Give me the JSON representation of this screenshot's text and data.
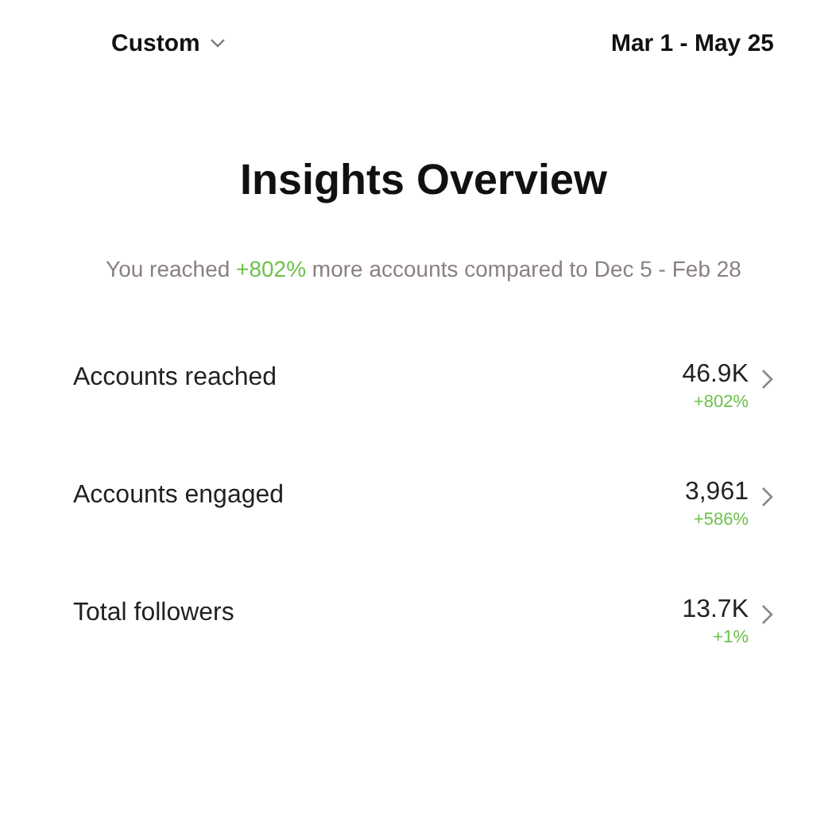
{
  "header": {
    "range_picker": "Custom",
    "date_range": "Mar 1 - May 25"
  },
  "title": "Insights Overview",
  "summary": "You reached **+802%** more accounts compared to Dec 5 - Feb 28",
  "metrics": [
    {
      "label": "Accounts reached",
      "value": "46.9K",
      "change": "+802%"
    },
    {
      "label": "Accounts engaged",
      "value": "3,961",
      "change": "+586%"
    },
    {
      "label": "Total followers",
      "value": "13.7K",
      "change": "+1%"
    }
  ]
}
